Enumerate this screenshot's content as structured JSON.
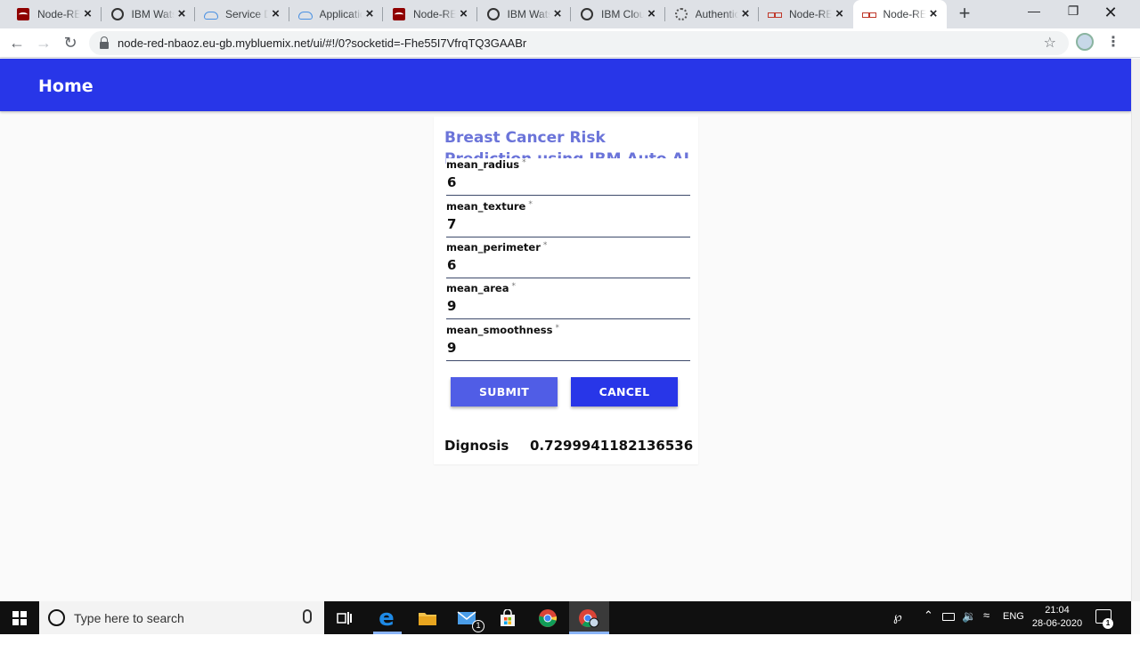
{
  "browser": {
    "tabs": [
      {
        "title": "Node-RED",
        "favicon": "node-red-icon"
      },
      {
        "title": "IBM Watson",
        "favicon": "watson-icon"
      },
      {
        "title": "Service Details",
        "favicon": "cloud-icon"
      },
      {
        "title": "Application",
        "favicon": "cloud-icon"
      },
      {
        "title": "Node-RED",
        "favicon": "node-red-icon"
      },
      {
        "title": "IBM Watson",
        "favicon": "watson-icon"
      },
      {
        "title": "IBM Cloud",
        "favicon": "watson-icon"
      },
      {
        "title": "Authentication",
        "favicon": "auth-icon"
      },
      {
        "title": "Node-RED",
        "favicon": "flow-icon"
      },
      {
        "title": "Node-RED",
        "favicon": "flow-icon"
      }
    ],
    "active_tab_index": 9,
    "url": "node-red-nbaoz.eu-gb.mybluemix.net/ui/#!/0?socketid=-Fhe55I7VfrqTQ3GAABr",
    "new_tab_label": "+",
    "close_glyph": "×"
  },
  "app": {
    "header_title": "Home",
    "header_color": "#2836e8",
    "form": {
      "title": "Breast Cancer Risk Prediction using IBM Auto AI",
      "required_marker": "*",
      "fields": [
        {
          "label": "mean_radius",
          "value": "6"
        },
        {
          "label": "mean_texture",
          "value": "7"
        },
        {
          "label": "mean_perimeter",
          "value": "6"
        },
        {
          "label": "mean_area",
          "value": "9"
        },
        {
          "label": "mean_smoothness",
          "value": "9"
        }
      ],
      "submit_label": "SUBMIT",
      "cancel_label": "CANCEL",
      "submit_color": "#505de6",
      "cancel_color": "#2836e8"
    },
    "result": {
      "label": "Dignosis",
      "value": "0.7299941182136536"
    }
  },
  "taskbar": {
    "search_placeholder": "Type here to search",
    "language": "ENG",
    "time": "21:04",
    "date": "28-06-2020",
    "notification_count": "1",
    "mail_badge": "1"
  }
}
